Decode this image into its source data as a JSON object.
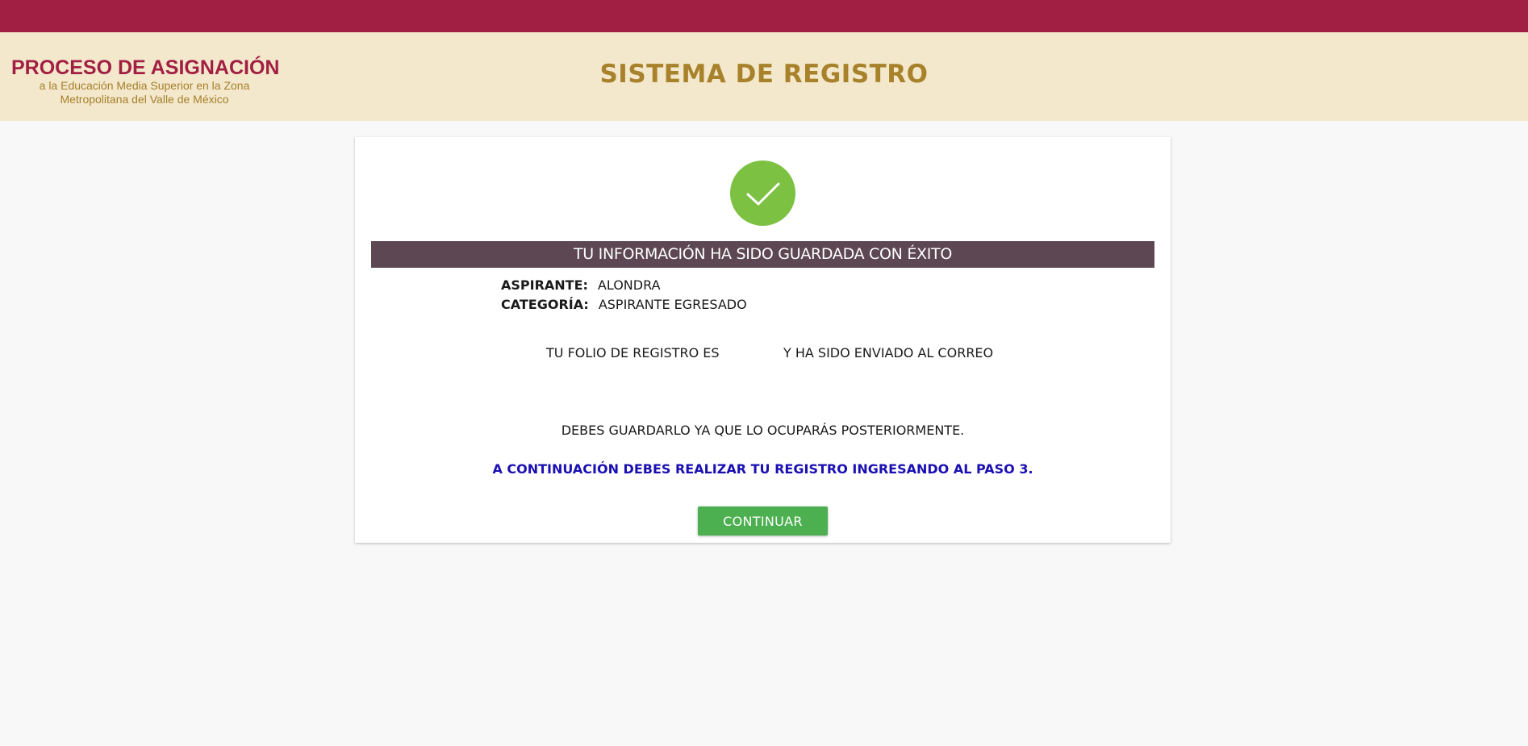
{
  "header": {
    "logo": {
      "title": "PROCESO DE ASIGNACIÓN",
      "subtitle_line1": "a la Educación Media Superior en la Zona",
      "subtitle_line2": "Metropolitana del Valle de México"
    },
    "system_title": "SISTEMA DE REGISTRO"
  },
  "confirmation": {
    "icon": "check-icon",
    "banner": "TU INFORMACIÓN HA SIDO GUARDADA CON ÉXITO",
    "aspirante_label": "ASPIRANTE:",
    "aspirante_value": "ALONDRA",
    "categoria_label": "CATEGORÍA:",
    "categoria_value": "ASPIRANTE EGRESADO",
    "folio_text_left": "TU FOLIO DE REGISTRO ES",
    "folio_text_right": "Y HA SIDO ENVIADO AL CORREO",
    "save_note": "DEBES GUARDARLO YA QUE LO OCUPARÁS POSTERIORMENTE.",
    "next_step": "A CONTINUACIÓN DEBES REALIZAR TU REGISTRO INGRESANDO AL PASO 3.",
    "continue_label": "CONTINUAR"
  },
  "colors": {
    "top_bar": "#a21f44",
    "header_bg": "#f3e8cc",
    "gold": "#a8822b",
    "banner_bg": "#5c4752",
    "success_green": "#7cc142",
    "button_green": "#4caf50",
    "link_blue": "#1a0fb3"
  }
}
